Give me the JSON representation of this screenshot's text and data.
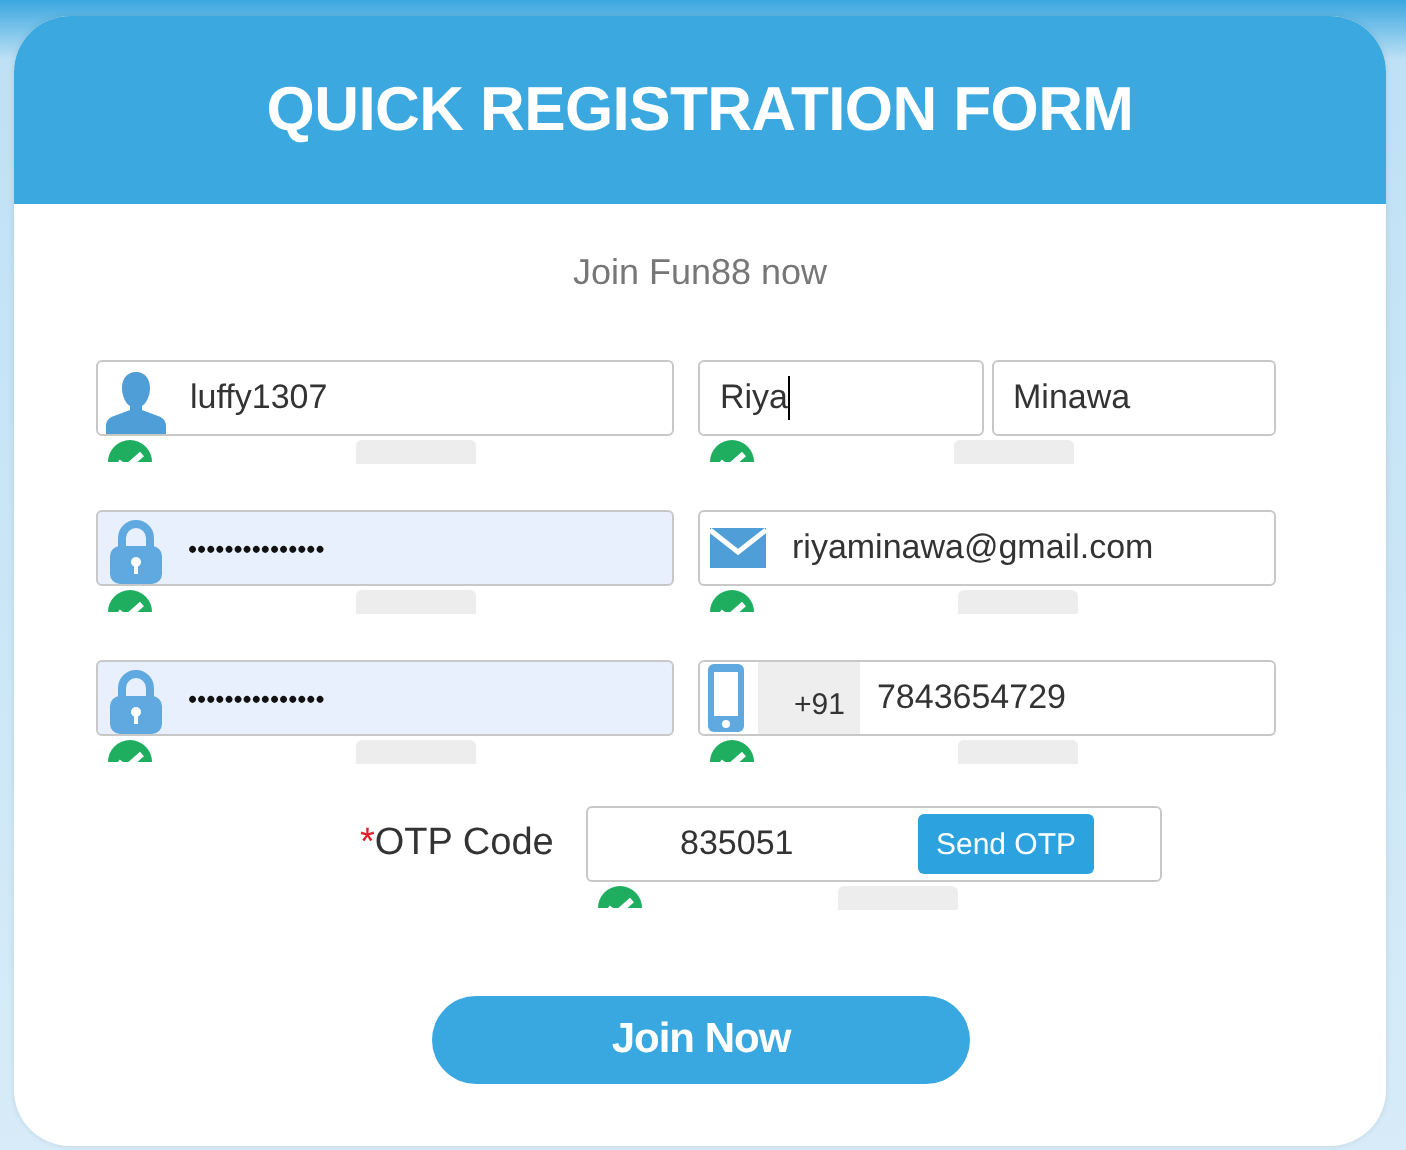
{
  "header": {
    "title": "QUICK REGISTRATION FORM"
  },
  "subtitle": "Join Fun88 now",
  "rows": [
    [
      {
        "kind": "user",
        "value": "luffy1307",
        "valid": true,
        "autofilled": false
      },
      {
        "kind": "names",
        "parts": [
          {
            "value": "Riya",
            "focused": true
          },
          {
            "value": "Minawa",
            "focused": false
          }
        ],
        "valid": true
      }
    ],
    [
      {
        "kind": "password",
        "value": "•••••••••••••••",
        "valid": true,
        "autofilled": true
      },
      {
        "kind": "email",
        "value": "riyaminawa@gmail.com",
        "valid": true,
        "autofilled": false
      }
    ],
    [
      {
        "kind": "password",
        "value": "•••••••••••••••",
        "valid": true,
        "autofilled": true
      },
      {
        "kind": "phone",
        "prefix": "+91",
        "value": "7843654729",
        "valid": true,
        "autofilled": false
      }
    ]
  ],
  "otp": {
    "required_mark": "*",
    "label": "OTP Code",
    "value": "835051",
    "button": "Send OTP",
    "valid": true
  },
  "submit": "Join Now"
}
